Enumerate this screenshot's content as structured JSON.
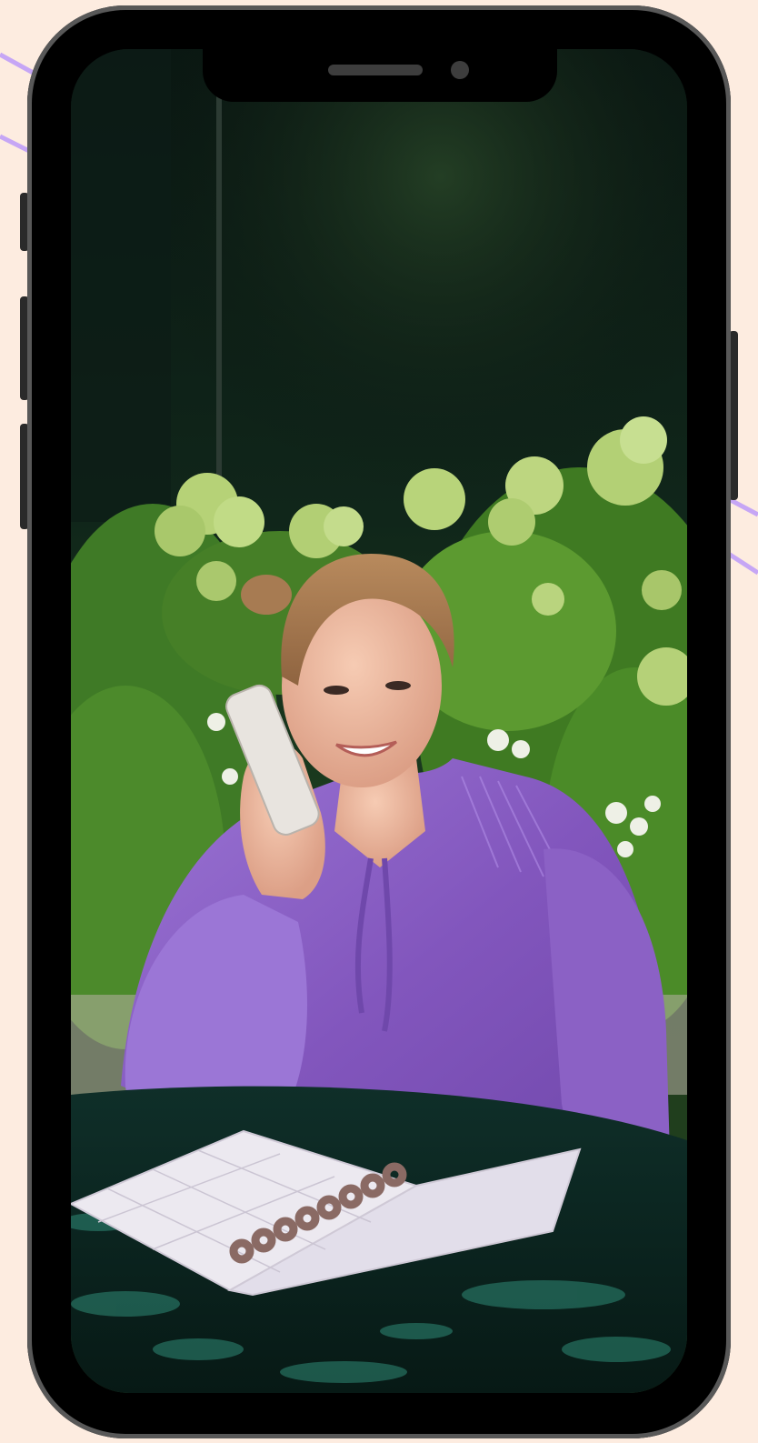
{
  "scene": {
    "subject": "woman-on-phone-call-with-planner",
    "colors": {
      "page_background": "#fdece0",
      "deco_line": "#c6a6f5",
      "phone_frame": "#000000",
      "phone_bezel_edge": "#585858",
      "blouse": "#8d62c6",
      "foliage": "#5f9a2c",
      "hydrangea": "#b7d37a",
      "table": "#0d2a25",
      "planner_page": "#e9e6ef"
    }
  }
}
